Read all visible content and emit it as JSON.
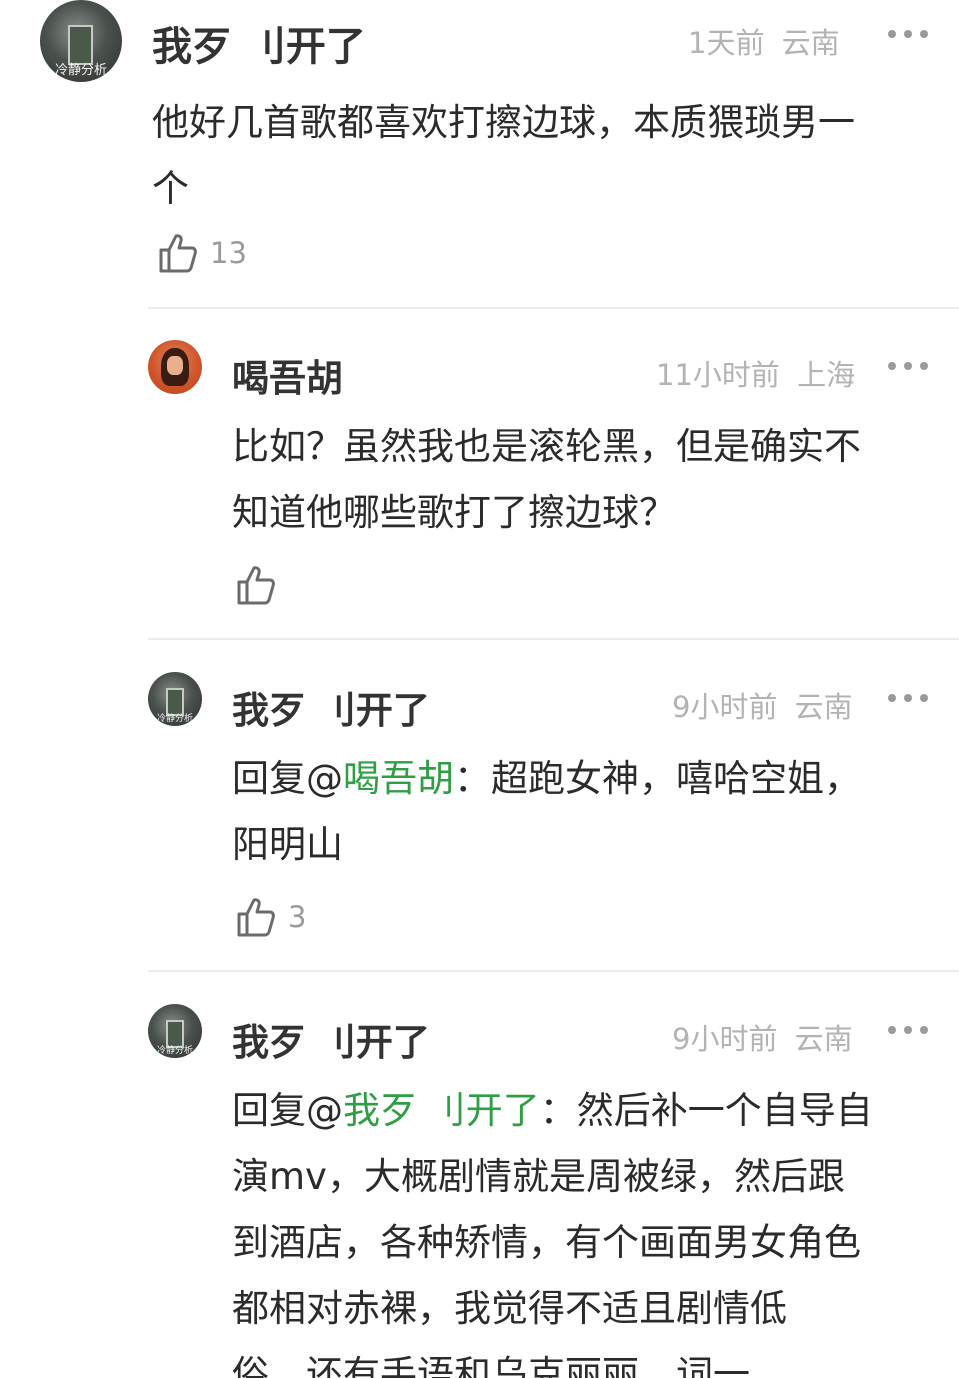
{
  "comments": [
    {
      "author": "我歹 刂开了",
      "avatar_watermark": "冷静分析",
      "time": "1天前",
      "location": "云南",
      "text_lines": [
        "他好几首歌都喜欢打擦边球，本质猥琐男一",
        "个"
      ],
      "likes": "13"
    },
    {
      "author": "喝吾胡",
      "time": "11小时前",
      "location": "上海",
      "text_lines": [
        "比如？虽然我也是滚轮黑，但是确实不",
        "知道他哪些歌打了擦边球？"
      ],
      "likes": ""
    },
    {
      "author": "我歹 刂开了",
      "avatar_watermark": "冷静分析",
      "time": "9小时前",
      "location": "云南",
      "reply_prefix": "回复@",
      "reply_to": "喝吾胡",
      "reply_sep": "：",
      "text_first": "超跑女神，嘻哈空姐，",
      "text_lines": [
        "阳明山"
      ],
      "likes": "3"
    },
    {
      "author": "我歹 刂开了",
      "avatar_watermark": "冷静分析",
      "time": "9小时前",
      "location": "云南",
      "reply_prefix": "回复@",
      "reply_to": "我歹 刂开了",
      "reply_sep": "：",
      "text_first": "然后补一个自导自",
      "text_lines": [
        "演mv，大概剧情就是周被绿，然后跟",
        "到酒店，各种矫情，有个画面男女角色",
        "都相对赤裸，我觉得不适且剧情低",
        "俗。还有手语和乌克丽丽，词一"
      ]
    }
  ],
  "icons": {
    "like": "thumbs-up-icon",
    "more": "more-dots-icon"
  },
  "colors": {
    "mention": "#2f9e44",
    "meta": "#b3b3b3",
    "text": "#2b2b2b"
  }
}
